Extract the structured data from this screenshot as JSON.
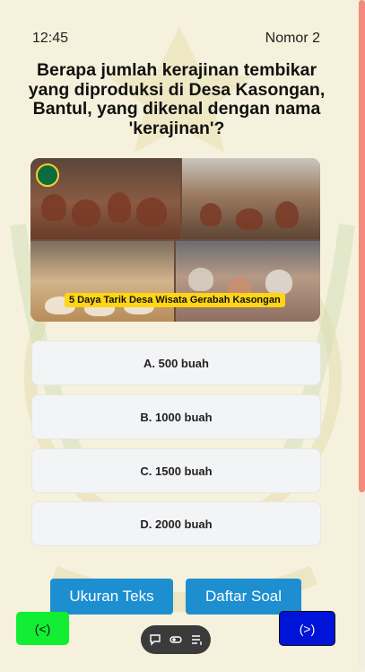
{
  "status": {
    "time": "12:45",
    "number": "Nomor 2"
  },
  "question": "Berapa jumlah kerajinan tembikar yang diproduksi di Desa Kasongan, Bantul, yang dikenal dengan nama 'kerajinan'?",
  "image": {
    "caption": "5 Daya Tarik Desa Wisata Gerabah Kasongan"
  },
  "options": [
    {
      "label": "A. 500 buah"
    },
    {
      "label": "B. 1000 buah"
    },
    {
      "label": "C. 1500 buah"
    },
    {
      "label": "D. 2000 buah"
    }
  ],
  "buttons": {
    "text_size": "Ukuran Teks",
    "question_list": "Daftar Soal",
    "prev": "(<)",
    "next": "(>)"
  },
  "icons": [
    "chat-bubble-icon",
    "toggle-icon",
    "list-icon"
  ],
  "colors": {
    "background": "#f6f1dc",
    "primary_button": "#1d8fd0",
    "prev_button": "#11ee33",
    "next_button": "#0014d9",
    "option_background": "#f3f4f6",
    "scroll_thumb": "#f28b7b"
  }
}
